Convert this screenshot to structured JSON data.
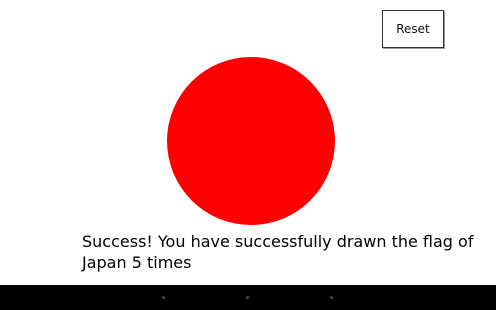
{
  "toolbar": {
    "reset_label": "Reset"
  },
  "flag": {
    "circle_color": "#ff0000",
    "background_color": "#ffffff"
  },
  "status": {
    "message": "Success! You have successfully drawn the flag of Japan 5 times"
  },
  "nav_bar": {
    "buttons": [
      "back-icon",
      "home-icon",
      "recent-apps-icon"
    ]
  }
}
